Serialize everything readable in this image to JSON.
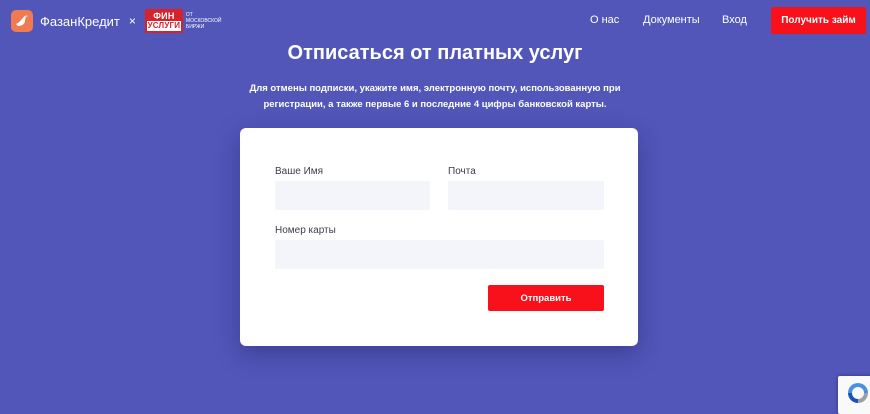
{
  "header": {
    "brand_name": "ФазанКредит",
    "separator": "×",
    "partner_line1": "ФИН",
    "partner_line2": "УСЛУГИ",
    "partner_sub": "ОТ МОСКОВСКОЙ БИРЖИ",
    "nav": [
      "О нас",
      "Документы",
      "Вход"
    ],
    "cta_label": "Получить займ"
  },
  "hero": {
    "title": "Отписаться от платных услуг",
    "description": "Для отмены подписки, укажите имя, электронную почту, использованную при регистрации, а также первые 6 и последние 4 цифры банковской карты."
  },
  "form": {
    "name_label": "Ваше Имя",
    "name_value": "",
    "email_label": "Почта",
    "email_value": "",
    "card_label": "Номер карты",
    "card_value": "",
    "submit_label": "Отправить"
  },
  "colors": {
    "background": "#5256b9",
    "accent": "#f8101a",
    "brand_logo": "#f07b52"
  },
  "icons": [
    "pheasant-logo-icon",
    "recaptcha-icon"
  ]
}
